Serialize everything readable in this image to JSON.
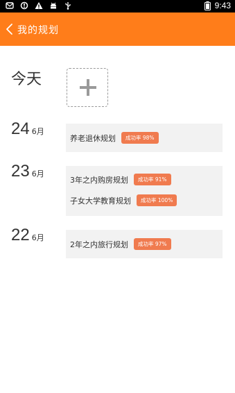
{
  "status_bar": {
    "time": "9:43",
    "left_icons": [
      "mail-icon",
      "sync-alert-icon",
      "warning-icon",
      "android-icon",
      "usb-icon"
    ],
    "right_icons": [
      "battery-icon"
    ]
  },
  "app_bar": {
    "title": "我的规划",
    "back_icon": "chevron-left-icon",
    "color": "#ff7d1a"
  },
  "today": {
    "label": "今天",
    "add_icon": "plus-icon"
  },
  "days": [
    {
      "day": "24",
      "month": "6月",
      "plans": [
        {
          "name": "养老退休规划",
          "badge": "成功率 98%"
        }
      ]
    },
    {
      "day": "23",
      "month": "6月",
      "plans": [
        {
          "name": "3年之内购房规划",
          "badge": "成功率 91%"
        },
        {
          "name": "子女大学教育规划",
          "badge": "成功率 100%"
        }
      ]
    },
    {
      "day": "22",
      "month": "6月",
      "plans": [
        {
          "name": "2年之内旅行规划",
          "badge": "成功率 97%"
        }
      ]
    }
  ],
  "colors": {
    "badge": "#f07b4f",
    "card_bg": "#f2f2f2"
  }
}
